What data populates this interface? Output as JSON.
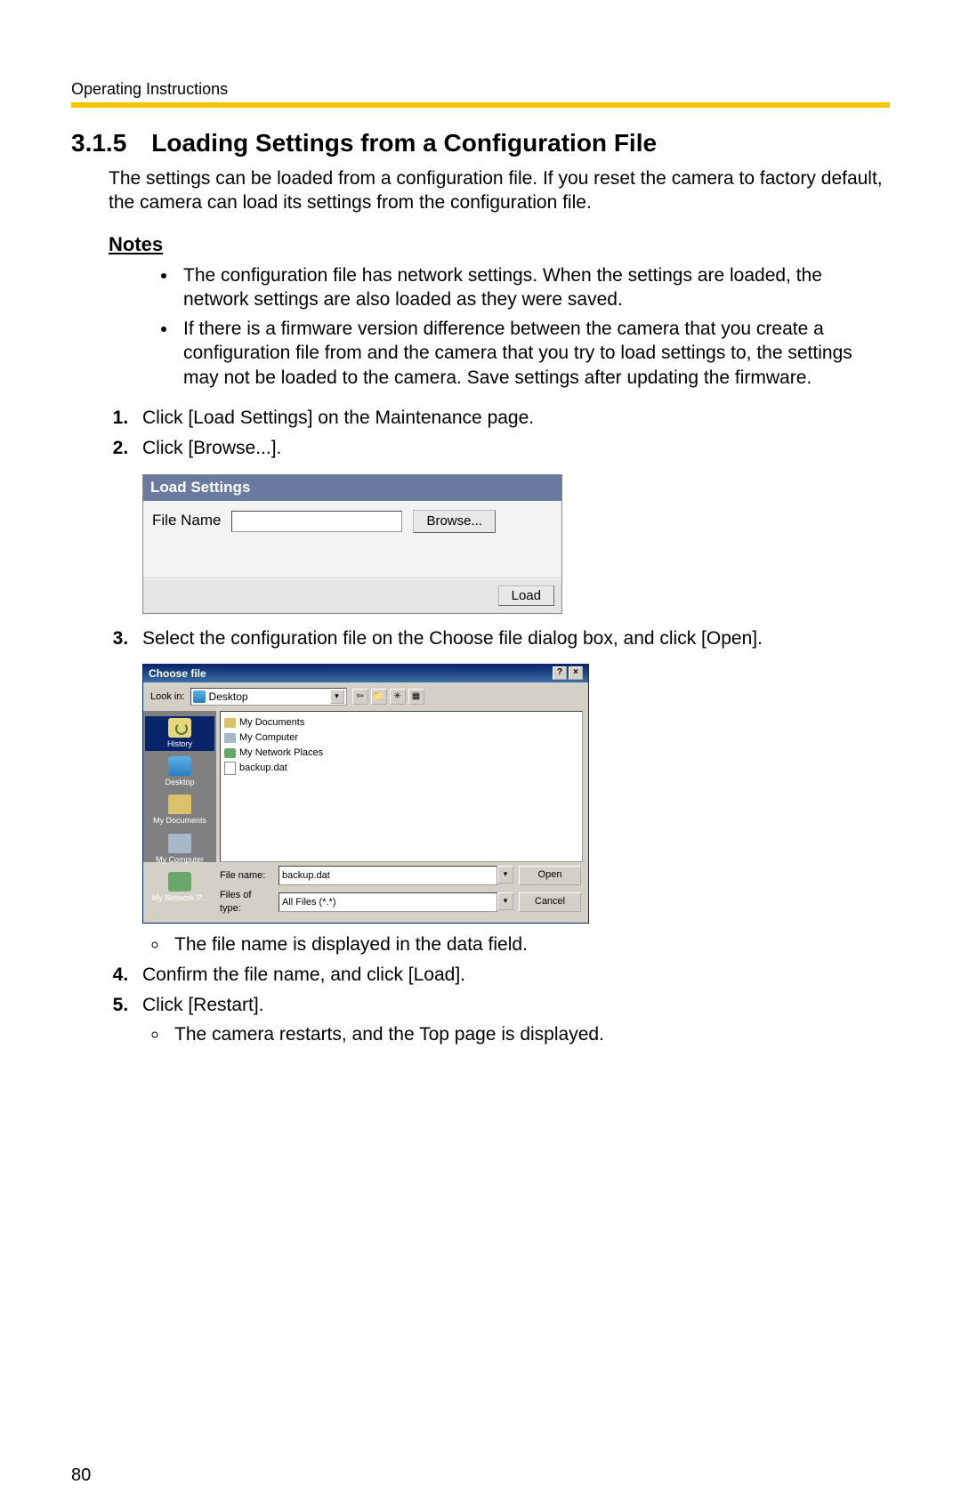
{
  "header": "Operating Instructions",
  "section": {
    "number": "3.1.5",
    "title": "Loading Settings from a Configuration File"
  },
  "intro": "The settings can be loaded from a configuration file. If you reset the camera to factory default, the camera can load its settings from the configuration file.",
  "notes_heading": "Notes",
  "notes": [
    "The configuration file has network settings. When the settings are loaded, the network settings are also loaded as they were saved.",
    "If there is a firmware version difference between the camera that you create a configuration file from and the camera that you try to load settings to, the settings may not be loaded to the camera. Save settings after updating the firmware."
  ],
  "steps": {
    "s1": "Click [Load Settings] on the Maintenance page.",
    "s2": "Click [Browse...].",
    "s3": "Select the configuration file on the Choose file dialog box, and click [Open].",
    "s3_sub": "The file name is displayed in the data field.",
    "s4": "Confirm the file name, and click [Load].",
    "s5": "Click [Restart].",
    "s5_sub": "The camera restarts, and the Top page is displayed."
  },
  "load_panel": {
    "title": "Load Settings",
    "file_label": "File Name",
    "browse": "Browse...",
    "load": "Load"
  },
  "choose_dialog": {
    "title": "Choose file",
    "lookin_label": "Look in:",
    "lookin_value": "Desktop",
    "sidebar": [
      "History",
      "Desktop",
      "My Documents",
      "My Computer",
      "My Network P..."
    ],
    "files": [
      "My Documents",
      "My Computer",
      "My Network Places",
      "backup.dat"
    ],
    "filename_label": "File name:",
    "filename_value": "backup.dat",
    "filetype_label": "Files of type:",
    "filetype_value": "All Files (*.*)",
    "open": "Open",
    "cancel": "Cancel"
  },
  "page_number": "80"
}
